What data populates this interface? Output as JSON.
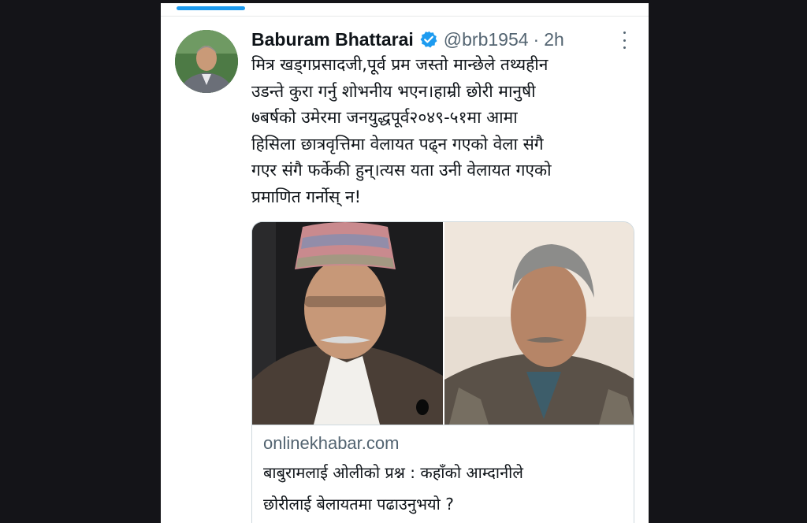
{
  "tweet": {
    "author": {
      "display_name": "Baburam Bhattarai",
      "handle": "@brb1954",
      "verified": true,
      "verified_icon": "verified-badge-icon"
    },
    "separator": "·",
    "time": "2h",
    "more_icon": "more-options-icon",
    "text_lines": [
      "मित्र खड्गप्रसादजी,पूर्व प्रम जस्तो मान्छेले तथ्यहीन",
      "उडन्ते कुरा गर्नु शोभनीय भएन।हाम्री छोरी मानुषी",
      "७बर्षको उमेरमा जनयुद्धपूर्व२०४९-५१मा आमा",
      "हिसिला छात्रवृत्तिमा वेलायत पढ्न गएको वेला संगै",
      "गएर संगै फर्केकी हुन्।त्यस यता उनी वेलायत गएको",
      "प्रमाणित गर्नोस् न!"
    ]
  },
  "link_card": {
    "domain": "onlinekhabar.com",
    "title_lines": [
      "बाबुरामलाई ओलीको प्रश्न : कहाँको आम्दानीले",
      "छोरीलाई बेलायतमा पढाउनुभयो ?"
    ]
  },
  "colors": {
    "accent": "#1d9bf0",
    "text_primary": "#0f1419",
    "text_secondary": "#536471",
    "border": "#cfd9de",
    "page_background": "#141418"
  }
}
